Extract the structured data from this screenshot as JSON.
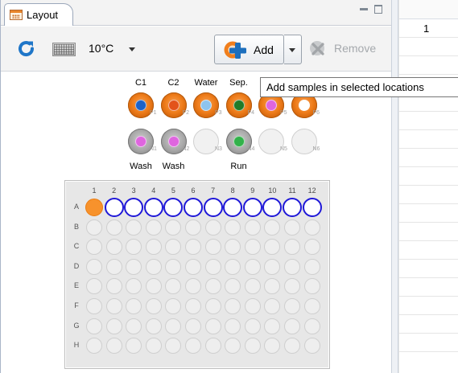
{
  "panel": {
    "tab_label": "Layout",
    "icons": {
      "tab": "layout-grid-icon",
      "minimize": "minimize-icon",
      "maximize": "maximize-icon"
    }
  },
  "toolbar": {
    "refresh_icon": "refresh-icon",
    "grid_icon": "plate-view-icon",
    "temperature": "10°C",
    "temperature_dropdown_icon": "chevron-down-icon",
    "add_label": "Add",
    "add_icon": "add-icon",
    "add_dropdown_icon": "chevron-down-icon",
    "remove_label": "Remove",
    "remove_icon": "remove-icon"
  },
  "tooltip": {
    "text": "Add samples in selected locations"
  },
  "vials": {
    "top_labels": [
      "C1",
      "C2",
      "Water",
      "Sep.",
      "",
      ""
    ],
    "top_positions": [
      "P1",
      "P2",
      "P3",
      "P4",
      "P5",
      "P6"
    ],
    "top_cores": [
      "#1b62c9",
      "#e3531a",
      "#8ec4ee",
      "#207b28",
      "#df65df",
      "#ffffff"
    ],
    "bottom_labels": [
      "Wash",
      "Wash",
      "",
      "Run",
      "",
      ""
    ],
    "bottom_positions": [
      "N1",
      "N2",
      "N3",
      "N4",
      "N5",
      "N6"
    ],
    "bottom_cores": [
      "#df65df",
      "#df65df",
      "",
      "#32b24a",
      "",
      ""
    ],
    "bottom_types": [
      "gray",
      "gray",
      "empty",
      "gray",
      "empty",
      "empty"
    ]
  },
  "plate": {
    "columns": [
      "1",
      "2",
      "3",
      "4",
      "5",
      "6",
      "7",
      "8",
      "9",
      "10",
      "11",
      "12"
    ],
    "rows": [
      "A",
      "B",
      "C",
      "D",
      "E",
      "F",
      "G",
      "H"
    ],
    "filled_well": "A1",
    "selected_wells": [
      "A2",
      "A3",
      "A4",
      "A5",
      "A6",
      "A7",
      "A8",
      "A9",
      "A10",
      "A11",
      "A12"
    ]
  },
  "right_table": {
    "first_value": "1"
  },
  "colors": {
    "accent_orange": "#f7922c",
    "selection_blue": "#1f18d8"
  }
}
